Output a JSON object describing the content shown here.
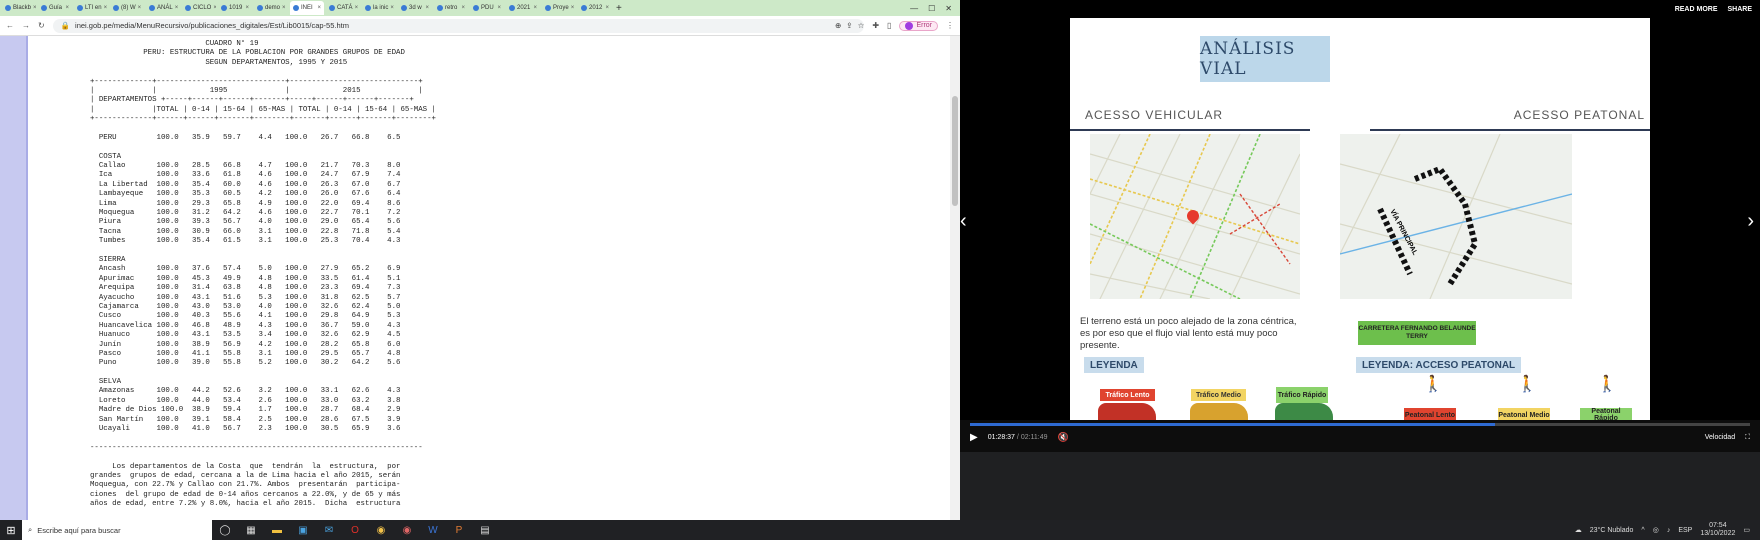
{
  "browser": {
    "tabs": [
      "Blackb",
      "Guía",
      "LTI en",
      "(8) W",
      "ANÁL",
      "CICLO",
      "1019",
      "demo",
      "INEI",
      "CATÁ",
      "la inic",
      "3d w",
      "retro",
      "PDU",
      "2021",
      "Proye",
      "2012"
    ],
    "active_tab_index": 8,
    "url": "inei.gob.pe/media/MenuRecursivo/publicaciones_digitales/Est/Lib0015/cap-55.htm",
    "error_badge": "Error"
  },
  "document": {
    "lines": [
      "                          CUADRO N° 19",
      "            PERU: ESTRUCTURA DE LA POBLACION POR GRANDES GRUPOS DE EDAD",
      "                          SEGUN DEPARTAMENTOS, 1995 Y 2015",
      "",
      "+-------------+-----------------------------+-----------------------------+",
      "|             |            1995             |            2015             |",
      "| DEPARTAMENTOS +-----+------+------+-------+-----+------+------+-------+",
      "|             |TOTAL | 0-14 | 15-64 | 65-MAS | TOTAL | 0-14 | 15-64 | 65-MAS |",
      "+-------------+------+------+-------+--------+-------+------+-------+--------+",
      "",
      "  PERU         100.0   35.9   59.7    4.4   100.0   26.7   66.8    6.5",
      "",
      "  COSTA",
      "  Callao       100.0   28.5   66.8    4.7   100.0   21.7   70.3    8.0",
      "  Ica          100.0   33.6   61.8    4.6   100.0   24.7   67.9    7.4",
      "  La Libertad  100.0   35.4   60.0    4.6   100.0   26.3   67.0    6.7",
      "  Lambayeque   100.0   35.3   60.5    4.2   100.0   26.0   67.6    6.4",
      "  Lima         100.0   29.3   65.8    4.9   100.0   22.0   69.4    8.6",
      "  Moquegua     100.0   31.2   64.2    4.6   100.0   22.7   70.1    7.2",
      "  Piura        100.0   39.3   56.7    4.0   100.0   29.0   65.4    5.6",
      "  Tacna        100.0   30.9   66.0    3.1   100.0   22.8   71.8    5.4",
      "  Tumbes       100.0   35.4   61.5    3.1   100.0   25.3   70.4    4.3",
      "",
      "  SIERRA",
      "  Ancash       100.0   37.6   57.4    5.0   100.0   27.9   65.2    6.9",
      "  Apurimac     100.0   45.3   49.9    4.8   100.0   33.5   61.4    5.1",
      "  Arequipa     100.0   31.4   63.8    4.8   100.0   23.3   69.4    7.3",
      "  Ayacucho     100.0   43.1   51.6    5.3   100.0   31.8   62.5    5.7",
      "  Cajamarca    100.0   43.0   53.0    4.0   100.0   32.6   62.4    5.0",
      "  Cusco        100.0   40.3   55.6    4.1   100.0   29.8   64.9    5.3",
      "  Huancavelica 100.0   46.8   48.9    4.3   100.0   36.7   59.0    4.3",
      "  Huanuco      100.0   43.1   53.5    3.4   100.0   32.6   62.9    4.5",
      "  Junín        100.0   38.9   56.9    4.2   100.0   28.2   65.8    6.0",
      "  Pasco        100.0   41.1   55.8    3.1   100.0   29.5   65.7    4.8",
      "  Puno         100.0   39.0   55.8    5.2   100.0   30.2   64.2    5.6",
      "",
      "  SELVA",
      "  Amazonas     100.0   44.2   52.6    3.2   100.0   33.1   62.6    4.3",
      "  Loreto       100.0   44.0   53.4    2.6   100.0   33.0   63.2    3.8",
      "  Madre de Dios 100.0  38.9   59.4    1.7   100.0   28.7   68.4    2.9",
      "  San Martín   100.0   39.1   58.4    2.5   100.0   28.6   67.5    3.9",
      "  Ucayali      100.0   41.0   56.7    2.3   100.0   30.5   65.9    3.6",
      "",
      "---------------------------------------------------------------------------",
      "",
      "     Los departamentos de la Costa  que  tendrán  la  estructura,  por",
      "grandes  grupos de edad, cercana a la de Lima hacia el año 2015, serán",
      "Moquegua, con 22.7% y Callao con 21.7%. Ambos  presentarán  participa-",
      "ciones  del grupo de edad de 0-14 años cercanos a 22.0%, y de 65 y más",
      "años de edad, entre 7.2% y 8.0%, hacia el año 2015.  Dicha  estructura"
    ]
  },
  "taskbar": {
    "search_placeholder": "Escribe aquí para buscar",
    "weather": "23°C  Nublado",
    "lang": "ESP",
    "time": "07:54",
    "date": "13/10/2022"
  },
  "video": {
    "read_more": "READ MORE",
    "share": "SHARE",
    "current_time": "01:28:37",
    "total_time": "02:11:49",
    "speed_label": "Velocidad",
    "progress": 0.673
  },
  "slide": {
    "title": "ANÁLISIS VIAL",
    "left_heading": "ACESSO VEHICULAR",
    "right_heading": "ACESSO PEATONAL",
    "description": "El terreno está un poco alejado de la zona céntrica, es por eso que el flujo vial lento está muy poco presente.",
    "road_label": "CARRETERA FERNANDO BELAUNDE TERRY",
    "via_principal": "VÍA PRINCIPAL",
    "legend_left": "LEYENDA",
    "legend_right": "LEYENDA: ACCESO PEATONAL",
    "traffic": [
      "Tráfico Lento",
      "Tráfico Medio",
      "Tráfico Rápido"
    ],
    "pedestrian": [
      "Peatonal Lento",
      "Peatonal Medio",
      "Peatonal Rápido"
    ],
    "colors": {
      "slow": "#e0442f",
      "medium": "#f2d463",
      "fast": "#8bd26b"
    }
  }
}
